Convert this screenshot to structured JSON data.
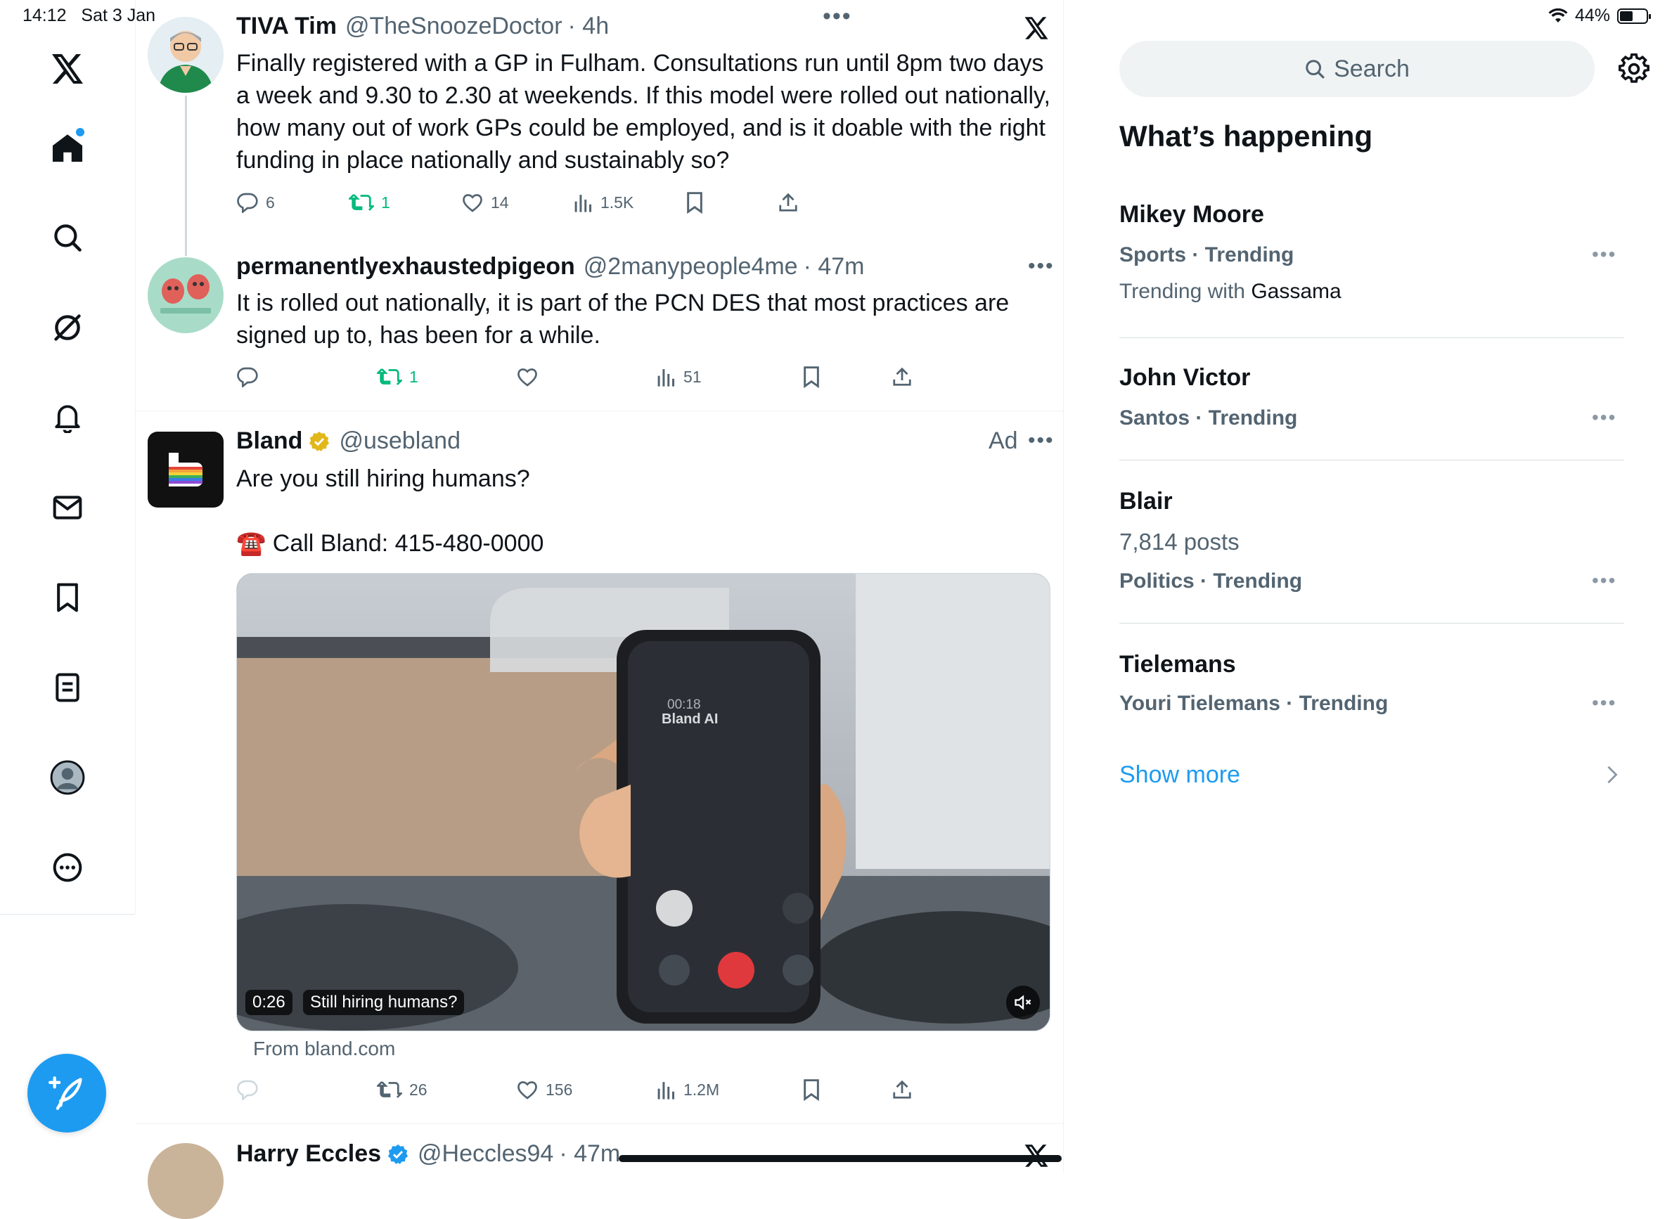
{
  "status": {
    "time": "14:12",
    "date": "Sat 3 Jan",
    "battery": "44%"
  },
  "nav": {
    "items": [
      "x-logo",
      "home",
      "explore",
      "grok",
      "notifications",
      "messages",
      "bookmarks",
      "lists",
      "profile",
      "more"
    ]
  },
  "tweets": [
    {
      "name": "TIVA Tim",
      "handle": "@TheSnoozeDoctor",
      "time": "· 4h",
      "text": "Finally registered with a GP in Fulham. Consultations run until 8pm two days a week and 9.30 to 2.30 at weekends. If this model were rolled out nationally, how many out of work GPs could be employed, and is it doable with the right funding in place nationally and sustainably so?",
      "replies": "6",
      "retweets": "1",
      "likes": "14",
      "views": "1.5K"
    },
    {
      "name": "permanentlyexhaustedpigeon",
      "handle": "@2manypeople4me",
      "time": "· 47m",
      "text": "It is rolled out nationally, it is part of the PCN DES that most practices are signed up to, has been for a while.",
      "replies": "",
      "retweets": "1",
      "likes": "",
      "views": "51"
    },
    {
      "name": "Bland",
      "handle": "@usebland",
      "ad_label": "Ad",
      "text_line1": "Are you still hiring humans?",
      "text_line2": "☎️ Call Bland: 415-480-0000",
      "video_time": "0:26",
      "video_caption": "Still hiring humans?",
      "phone_label": "Bland AI",
      "phone_time": "00:18",
      "source": "From bland.com",
      "replies": "",
      "retweets": "26",
      "likes": "156",
      "views": "1.2M"
    },
    {
      "name": "Harry Eccles",
      "handle": "@Heccles94",
      "time": "· 47m"
    }
  ],
  "search": {
    "placeholder": "Search"
  },
  "whats_happening": {
    "title": "What’s happening",
    "trends": [
      {
        "title": "Mikey Moore",
        "context": "Sports · Trending",
        "extra_prefix": "Trending with ",
        "extra_name": "Gassama"
      },
      {
        "title": "John Victor",
        "context": "Santos · Trending"
      },
      {
        "title": "Blair",
        "posts": "7,814 posts",
        "context": "Politics · Trending"
      },
      {
        "title": "Tielemans",
        "context": "Youri Tielemans · Trending"
      }
    ],
    "show_more": "Show more"
  },
  "colors": {
    "accent": "#1d9bf0",
    "retweet": "#00ba7c",
    "text": "#0f1419",
    "secondary": "#536471"
  }
}
